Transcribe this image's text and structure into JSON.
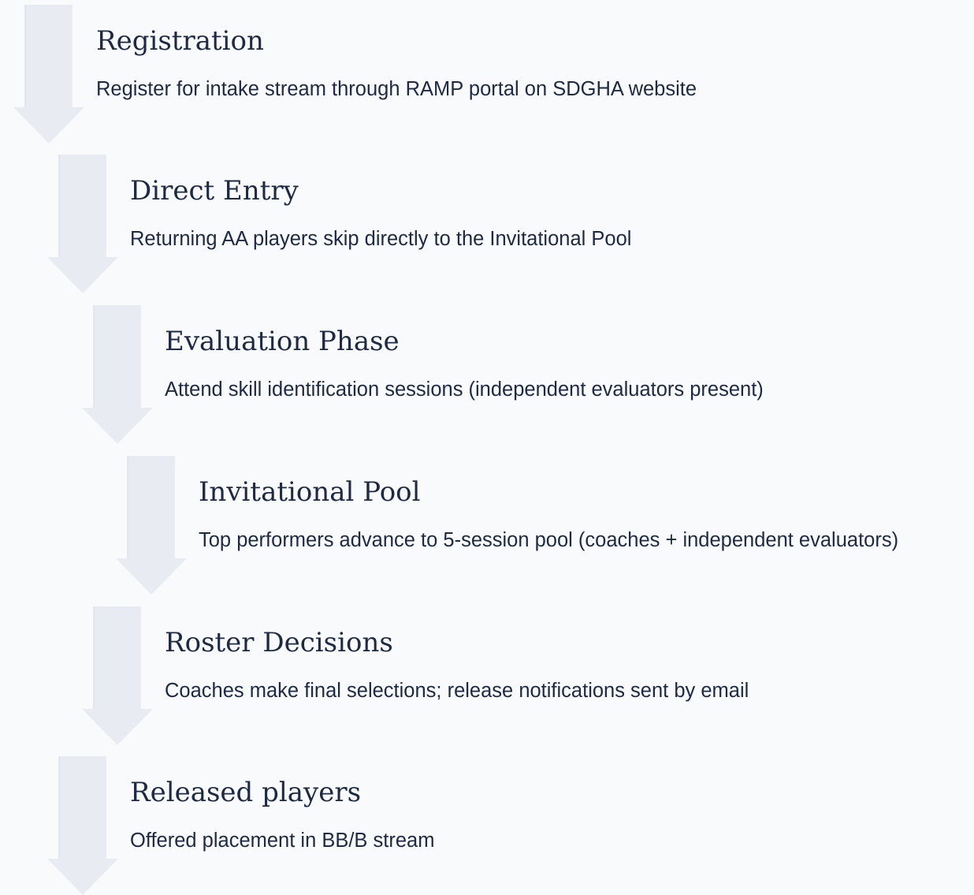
{
  "colors": {
    "background": "#f8fafc",
    "arrow_fill": "#e8ebf1",
    "arrow_edge": "#d5dae3",
    "text": "#1e2a45"
  },
  "steps": [
    {
      "title": "Registration",
      "description": "Register for intake stream through RAMP portal on SDGHA website",
      "icon": "down-arrow-icon"
    },
    {
      "title": "Direct Entry",
      "description": "Returning AA players skip directly to the Invitational Pool",
      "icon": "down-arrow-icon"
    },
    {
      "title": "Evaluation Phase",
      "description": "Attend skill identification sessions (independent evaluators present)",
      "icon": "down-arrow-icon"
    },
    {
      "title": "Invitational Pool",
      "description": "Top performers advance to 5-session pool (coaches + independent evaluators)",
      "icon": "down-arrow-icon"
    },
    {
      "title": "Roster Decisions",
      "description": "Coaches make final selections; release notifications sent by email",
      "icon": "down-arrow-icon"
    },
    {
      "title": "Released players",
      "description": "Offered placement in BB/B stream",
      "icon": "down-arrow-icon"
    }
  ]
}
